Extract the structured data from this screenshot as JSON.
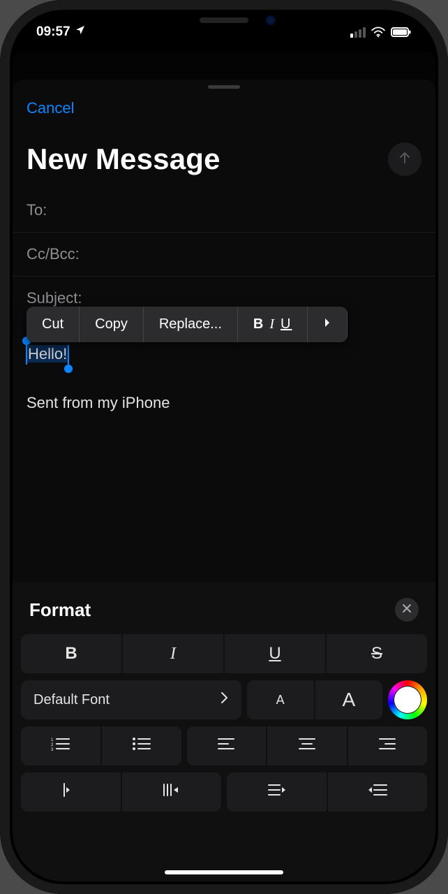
{
  "status": {
    "time": "09:57",
    "location_icon": "location-arrow-icon",
    "signal_icon": "cellular-signal-icon",
    "wifi_icon": "wifi-icon",
    "battery_icon": "battery-icon"
  },
  "sheet": {
    "cancel": "Cancel",
    "title": "New Message",
    "send_icon": "arrow-up-icon",
    "fields": {
      "to_label": "To:",
      "ccbcc_label": "Cc/Bcc:",
      "subject_label": "Subject:"
    },
    "body": {
      "selected_text": "Hello!",
      "signature": "Sent from my iPhone"
    },
    "context_menu": {
      "cut": "Cut",
      "copy": "Copy",
      "replace": "Replace...",
      "biu": "B I U",
      "more_icon": "chevron-right-icon"
    }
  },
  "format": {
    "title": "Format",
    "close_icon": "close-icon",
    "bold": "B",
    "italic": "I",
    "underline": "U",
    "strike": "S",
    "font_name": "Default Font",
    "font_chevron": "chevron-right-icon",
    "size_small": "A",
    "size_large": "A",
    "color_icon": "color-picker-icon",
    "list_number_icon": "numbered-list-icon",
    "list_bullet_icon": "bulleted-list-icon",
    "align_left_icon": "align-left-icon",
    "align_center_icon": "align-center-icon",
    "align_right_icon": "align-right-icon",
    "indent_left_icon": "outdent-icon",
    "indent_lines_icon": "indent-lines-icon",
    "indent_dec_icon": "decrease-indent-icon",
    "indent_inc_icon": "increase-indent-icon"
  }
}
